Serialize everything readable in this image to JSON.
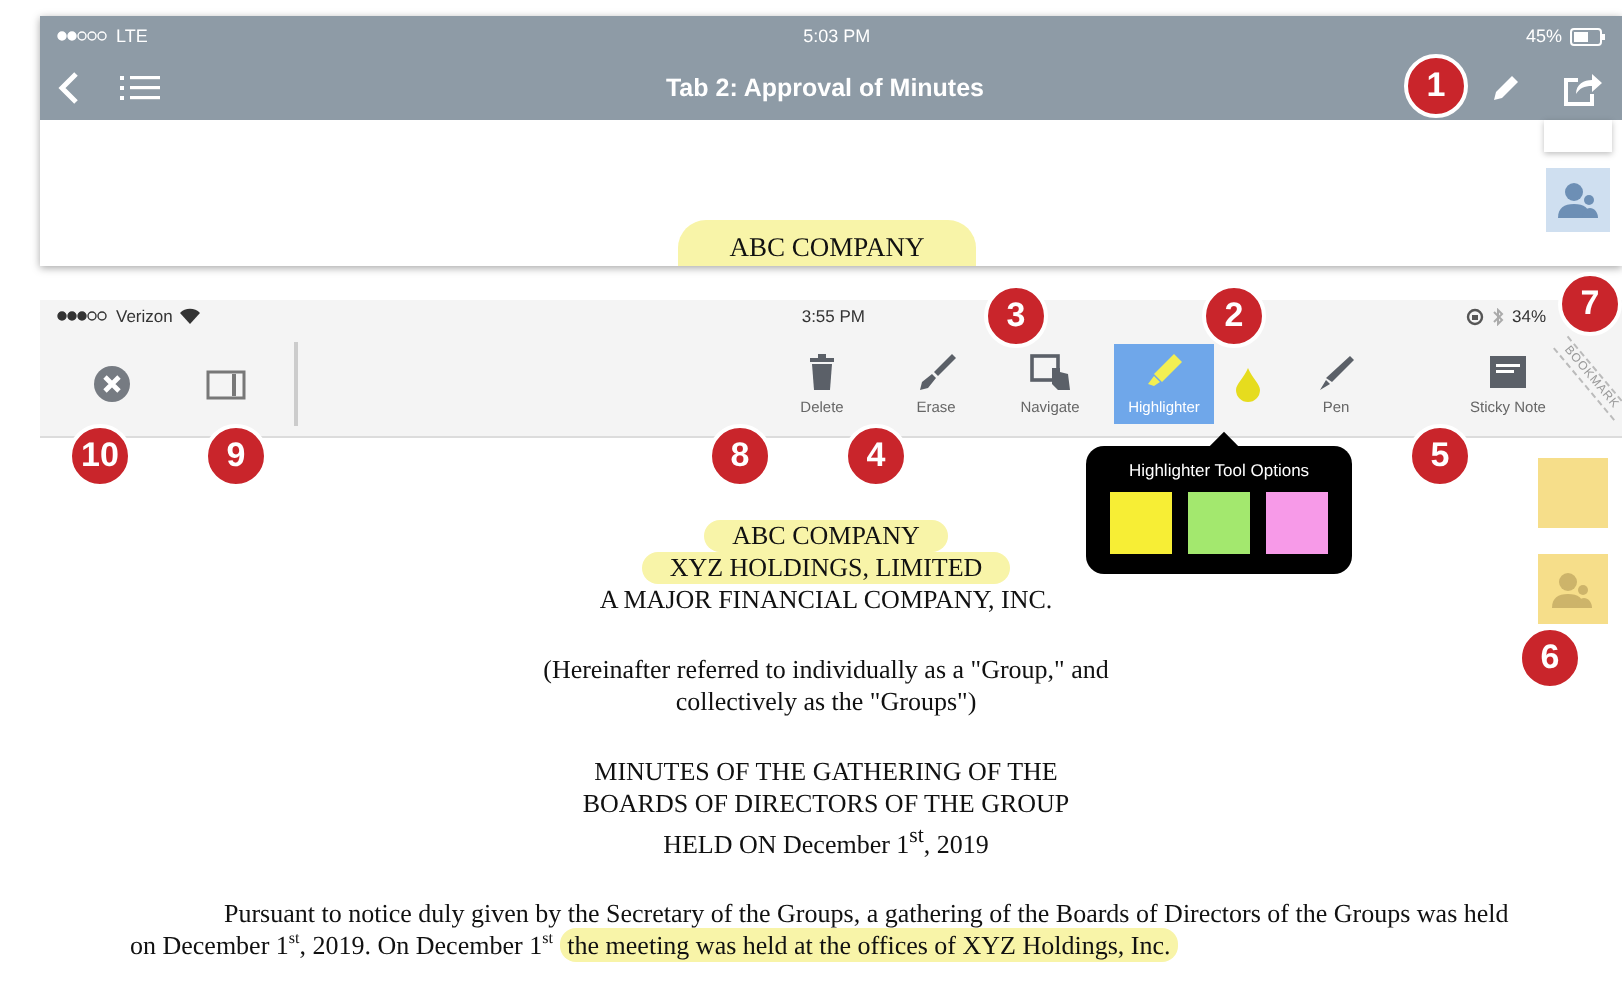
{
  "top_screen": {
    "status_bar": {
      "carrier": "LTE",
      "time": "5:03 PM",
      "battery": "45%"
    },
    "title": "Tab 2: Approval of Minutes",
    "document_heading": "ABC COMPANY"
  },
  "bottom_screen": {
    "status_bar": {
      "carrier": "Verizon",
      "time": "3:55 PM",
      "battery": "34%"
    },
    "tools": [
      {
        "label": "Delete",
        "kind": "delete",
        "selected": false
      },
      {
        "label": "Erase",
        "kind": "erase",
        "selected": false
      },
      {
        "label": "Navigate",
        "kind": "navigate",
        "selected": false
      },
      {
        "label": "Highlighter",
        "kind": "highlighter",
        "selected": true
      },
      {
        "label": "Pen",
        "kind": "pen",
        "selected": false
      },
      {
        "label": "Sticky Note",
        "kind": "sticky",
        "selected": false
      }
    ],
    "bookmark": "BOOKMARK",
    "highlighter_options": {
      "title": "Highlighter Tool Options",
      "colors": [
        {
          "color": "#f7ee35"
        },
        {
          "color": "#a3e86e"
        },
        {
          "color": "#f79ae8"
        }
      ]
    },
    "document": {
      "blocks": [
        {
          "lines": [
            {
              "text": "ABC COMPANY",
              "highlighted": true
            },
            {
              "text": "XYZ HOLDINGS, LIMITED",
              "highlighted": true
            },
            {
              "text": "A MAJOR FINANCIAL COMPANY, INC.",
              "highlighted": false
            }
          ]
        },
        {
          "lines": [
            {
              "text": "(Hereinafter referred to individually as a \"Group,\" and",
              "highlighted": false
            },
            {
              "text": "collectively as the \"Groups\")",
              "highlighted": false
            }
          ]
        },
        {
          "lines": [
            {
              "text": "MINUTES OF THE GATHERING OF THE",
              "highlighted": false
            },
            {
              "text": "BOARDS OF DIRECTORS OF THE GROUP",
              "highlighted": false
            },
            {
              "text": "HELD ON December 1$^{st}$, 2019",
              "highlighted": false
            }
          ]
        }
      ],
      "paragraph": {
        "text": "Pursuant to notice duly given by the Secretary of the Groups, a gathering of the Boards of Directors of the Groups was held on December 1$^{st}$, 2019. On December 1$^{st}$ ",
        "highlighted": "the meeting was held at the offices of XYZ Holdings, Inc."
      }
    }
  },
  "callouts": [
    {
      "number": "1"
    },
    {
      "number": "3"
    },
    {
      "number": "2"
    },
    {
      "number": "7"
    },
    {
      "number": "10"
    },
    {
      "number": "9"
    },
    {
      "number": "8"
    },
    {
      "number": "4"
    },
    {
      "number": "5"
    },
    {
      "number": "6"
    }
  ]
}
